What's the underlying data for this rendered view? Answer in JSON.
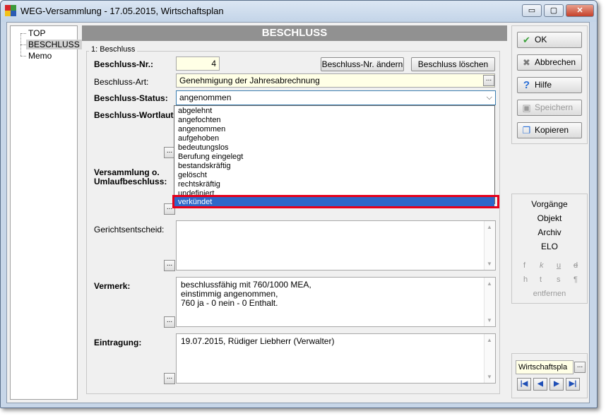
{
  "window": {
    "title": "WEG-Versammlung - 17.05.2015,  Wirtschaftsplan",
    "min_glyph": "▭",
    "max_glyph": "▢",
    "close_glyph": "✕"
  },
  "tree": {
    "items": [
      {
        "label": "TOP",
        "selected": false
      },
      {
        "label": "BESCHLUSS",
        "selected": true
      },
      {
        "label": "Memo",
        "selected": false
      }
    ]
  },
  "main": {
    "header": "BESCHLUSS",
    "group_title": "1: Beschluss",
    "nr_label": "Beschluss-Nr.:",
    "nr_value": "4",
    "nr_change_button": "Beschluss-Nr. ändern",
    "delete_button": "Beschluss löschen",
    "art_label": "Beschluss-Art:",
    "art_value": "Genehmigung der Jahresabrechnung",
    "status_label": "Beschluss-Status:",
    "status_value": "angenommen",
    "wortlaut_label": "Beschluss-Wortlaut:",
    "versammlung_label_1": "Versammlung o.",
    "versammlung_label_2": "Umlaufbeschluss:",
    "gericht_label": "Gerichtsentscheid:",
    "vermerk_label": "Vermerk:",
    "vermerk_lines": [
      "beschlussfähig mit 760/1000 MEA,",
      "einstimmig angenommen,",
      "760 ja -  0 nein -  0 Enthalt."
    ],
    "eintragung_label": "Eintragung:",
    "eintragung_value": "19.07.2015, Rüdiger Liebherr (Verwalter)",
    "dots": "...",
    "dropdown_options": [
      "abgelehnt",
      "angefochten",
      "angenommen",
      "aufgehoben",
      "bedeutungslos",
      "Berufung eingelegt",
      "bestandskräftig",
      "gelöscht",
      "rechtskräftig",
      "undefiniert",
      "verkündet"
    ],
    "highlighted_option": "verkündet"
  },
  "right": {
    "ok": "OK",
    "cancel": "Abbrechen",
    "help": "Hilfe",
    "save": "Speichern",
    "copy": "Kopieren",
    "links": [
      "Vorgänge",
      "Objekt",
      "Archiv",
      "ELO"
    ],
    "format_row1": [
      "f",
      "k",
      "u",
      "d"
    ],
    "format_row2": [
      "h",
      "t",
      "s",
      "¶"
    ],
    "remove": "entfernen",
    "plan_field": "Wirtschaftspla",
    "nav": [
      "|◀",
      "◀",
      "▶",
      "▶|"
    ]
  },
  "colors": {
    "highlight": "#2e67c9",
    "red_frame": "#e6001a",
    "header": "#919191",
    "field_bg": "#ffffe6"
  }
}
